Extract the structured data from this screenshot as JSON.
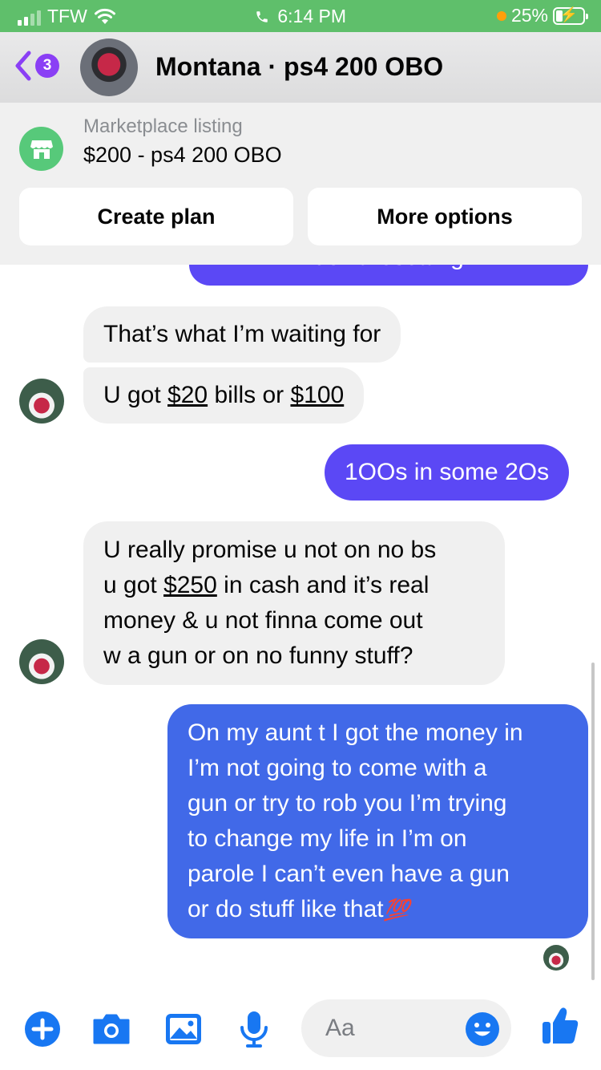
{
  "status_bar": {
    "carrier": "TFW",
    "time": "6:14 PM",
    "battery": "25%",
    "battery_level": 0.25,
    "accent": "#5fbf6b"
  },
  "header": {
    "back_badge": "3",
    "title": "Montana · ps4 200 OBO",
    "avatar_icon": "controller-photo"
  },
  "marketplace": {
    "subtitle": "Marketplace listing",
    "title": "$200 - ps4 200 OBO",
    "icon": "storefront-icon",
    "buttons": [
      "Create plan",
      "More options"
    ]
  },
  "messages": {
    "partial_text": "don't resetting",
    "m1": "That’s what I’m waiting for",
    "m2": {
      "pre": "U got ",
      "link1": "$20",
      "mid": " bills or ",
      "link2": "$100"
    },
    "m3": "1OOs in some 2Os",
    "m4": {
      "line1": "U really promise u not on no bs",
      "line2_pre": "u got ",
      "line2_link": "$250",
      "line2_post": " in cash and it’s real",
      "line3": "money  & u not finna come out",
      "line4": "w a gun or on no funny stuff?"
    },
    "m5": {
      "lines": [
        "On my aunt t I got the money in",
        "I’m not going to come with a",
        "gun or try to rob you I’m trying",
        "to change my life in I’m on",
        "parole I can’t even have a gun"
      ],
      "last_line": "or do stuff like that",
      "emoji": "💯"
    }
  },
  "composer": {
    "placeholder": "Aa",
    "icons": [
      "plus-icon",
      "camera-icon",
      "image-icon",
      "microphone-icon",
      "emoji-icon",
      "thumbs-up-icon"
    ],
    "accent": "#1877f2"
  },
  "colors": {
    "outgoing_bubble": "#5b48f5",
    "incoming_bubble": "#f0f0f0",
    "badge": "#8a3ff5"
  }
}
